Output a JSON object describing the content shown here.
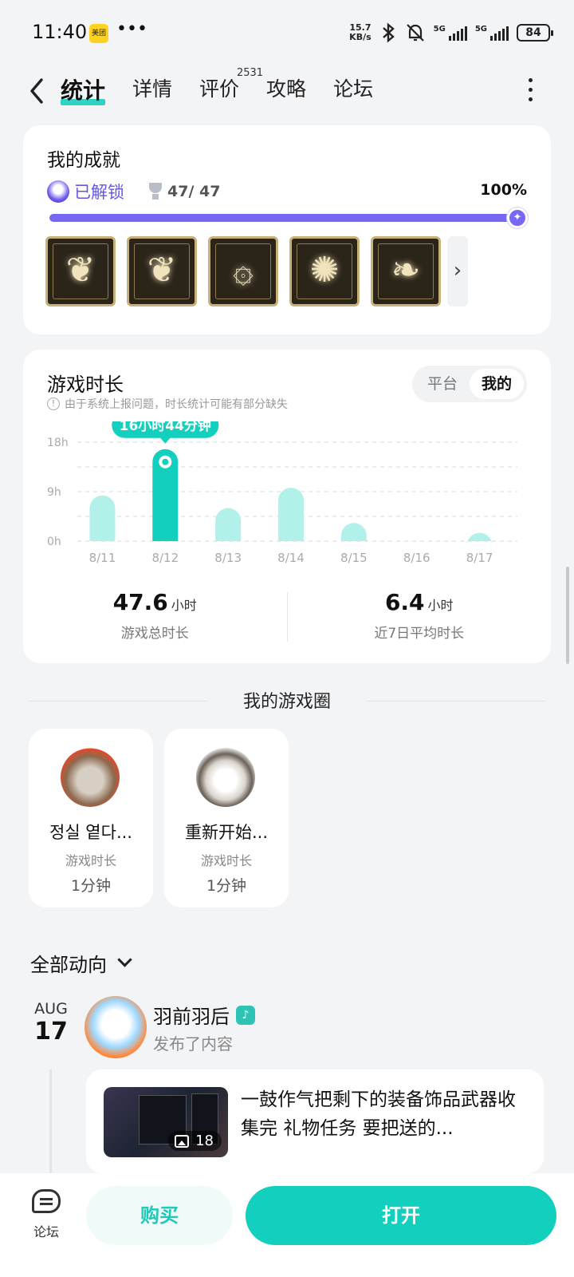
{
  "status_bar": {
    "time": "11:40",
    "app_badge": "美团",
    "net_speed_value": "15.7",
    "net_speed_unit": "KB/s",
    "signal1_label": "5G",
    "signal2_label": "5G",
    "battery": "84"
  },
  "nav": {
    "tabs": [
      {
        "label": "统计",
        "active": true
      },
      {
        "label": "详情"
      },
      {
        "label": "评价",
        "count": "2531"
      },
      {
        "label": "攻略"
      },
      {
        "label": "论坛"
      }
    ]
  },
  "achievements": {
    "title": "我的成就",
    "unlocked_label": "已解锁",
    "count": "47/ 47",
    "percent_label": "100%",
    "progress": 1.0,
    "badge_icons": [
      "heart-emblem-icon",
      "heart-emblem-icon",
      "flame-swirl-icon",
      "bird-head-icon",
      "wing-shoe-icon"
    ]
  },
  "playtime": {
    "title": "游戏时长",
    "note": "由于系统上报问题，时长统计可能有部分缺失",
    "toggle": {
      "left": "平台",
      "right": "我的",
      "selected": "我的"
    },
    "tooltip": "16小时44分钟",
    "total_value": "47.6",
    "total_unit": "小时",
    "total_label": "游戏总时长",
    "avg_value": "6.4",
    "avg_unit": "小时",
    "avg_label": "近7日平均时长"
  },
  "chart_data": {
    "type": "bar",
    "categories": [
      "8/11",
      "8/12",
      "8/13",
      "8/14",
      "8/15",
      "8/16",
      "8/17"
    ],
    "values": [
      8.3,
      16.73,
      6.0,
      9.7,
      3.3,
      0,
      1.5
    ],
    "yticks": [
      "0h",
      "9h",
      "18h"
    ],
    "ylim": [
      0,
      18
    ],
    "highlight_index": 1,
    "colors": {
      "bar": "#b2f0ea",
      "highlight": "#13cfbd"
    },
    "grid": true
  },
  "game_circle": {
    "title": "我的游戏圈",
    "items": [
      {
        "name": "정실 옅다...",
        "label": "游戏时长",
        "value": "1分钟"
      },
      {
        "name": "重新开始...",
        "label": "游戏时长",
        "value": "1分钟"
      }
    ]
  },
  "feed": {
    "filter_label": "全部动向",
    "month": "AUG",
    "day": "17",
    "user": "羽前羽后",
    "action": "发布了内容",
    "post_text": "一鼓作气把剩下的装备饰品武器收集完 礼物任务 要把送的...",
    "image_count": "18"
  },
  "bottom_bar": {
    "forum_label": "论坛",
    "buy_label": "购买",
    "open_label": "打开"
  }
}
